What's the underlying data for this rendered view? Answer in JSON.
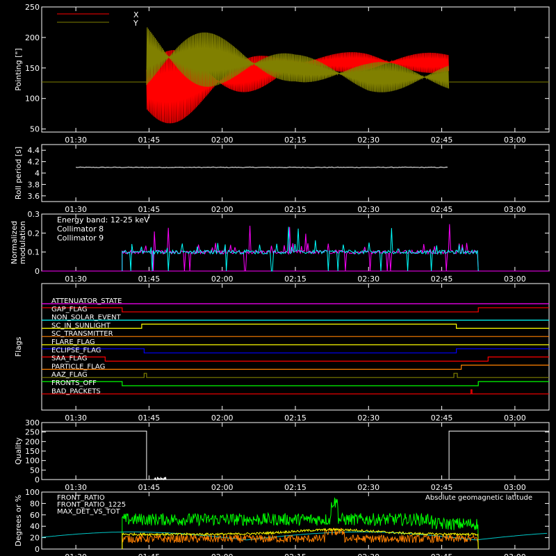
{
  "time_axis": {
    "tick_labels": [
      "01:30",
      "01:45",
      "02:00",
      "02:15",
      "02:30",
      "02:45",
      "03:00"
    ],
    "tick_minutes": [
      90,
      105,
      120,
      135,
      150,
      165,
      180
    ],
    "range_minutes": [
      83,
      187
    ]
  },
  "chart_data": [
    {
      "name": "pointing",
      "type": "line",
      "ylabel": "Pointing [\"]",
      "ylim": [
        45,
        250
      ],
      "yticks": [
        50,
        100,
        150,
        200,
        250
      ],
      "legend": "top-left",
      "series": [
        {
          "name": "X",
          "color": "#ff0000",
          "baseline": 127,
          "start": 104.5,
          "end": 166.5,
          "amp_start": [
            48,
            95
          ],
          "center_path": [
            [
              104.5,
              115
            ],
            [
              120,
              128
            ],
            [
              135,
              158
            ],
            [
              150,
              160
            ],
            [
              166.5,
              158
            ]
          ],
          "halfwidth_path": [
            [
              104.5,
              70
            ],
            [
              120,
              42
            ],
            [
              135,
              12
            ],
            [
              150,
              18
            ],
            [
              166.5,
              16
            ]
          ]
        },
        {
          "name": "Y",
          "color": "#808000",
          "baseline": 127,
          "start": 104.5,
          "end": 166.5,
          "center_path": [
            [
              104.5,
              170
            ],
            [
              120,
              162
            ],
            [
              135,
              150
            ],
            [
              150,
              135
            ],
            [
              166.5,
              135
            ]
          ],
          "halfwidth_path": [
            [
              104.5,
              65
            ],
            [
              120,
              40
            ],
            [
              135,
              22
            ],
            [
              150,
              25
            ],
            [
              166.5,
              24
            ]
          ]
        }
      ]
    },
    {
      "name": "roll_period",
      "type": "line",
      "ylabel": "Roll period [s]",
      "ylim": [
        3.5,
        4.5
      ],
      "yticks": [
        3.6,
        3.8,
        4.0,
        4.2,
        4.4
      ],
      "series": [
        {
          "color": "#ffffff",
          "start": 90,
          "end": 166.5,
          "value": 4.1
        }
      ]
    },
    {
      "name": "modulation",
      "type": "bar",
      "ylabel": "Normalized modulation",
      "ylim": [
        0,
        0.3
      ],
      "yticks": [
        0.0,
        0.1,
        0.2,
        0.3
      ],
      "annotations": [
        "Energy band: 12-25 keV"
      ],
      "series": [
        {
          "name": "Collimator 8",
          "color": "#00ffff",
          "start": 99.5,
          "end": 172.5,
          "base": 0.09
        },
        {
          "name": "Collimator 9",
          "color": "#ff00ff",
          "start": 99.5,
          "end": 172.5,
          "base": 0.09
        }
      ]
    },
    {
      "name": "flags",
      "type": "line",
      "ylabel": "Flags",
      "flags": [
        {
          "label": "ATTENUATOR_STATE",
          "color": "#ff00ff",
          "changes": []
        },
        {
          "label": "GAP_FLAG",
          "color": "#ff0000",
          "changes": [
            [
              99.5,
              1,
              0
            ],
            [
              172.5,
              0,
              1
            ]
          ]
        },
        {
          "label": "NON_SOLAR_EVENT",
          "color": "#00ffff",
          "changes": []
        },
        {
          "label": "SC_IN_SUNLIGHT",
          "color": "#ffff00",
          "changes": [
            [
              103.5,
              0,
              1
            ],
            [
              168,
              1,
              0
            ]
          ]
        },
        {
          "label": "SC_TRANSMITTER",
          "color": "#ff8000",
          "changes": []
        },
        {
          "label": "FLARE_FLAG",
          "color": "#ffff00",
          "changes": []
        },
        {
          "label": "ECLIPSE_FLAG",
          "color": "#0000ff",
          "changes": [
            [
              104,
              1,
              0
            ],
            [
              168,
              0,
              1
            ]
          ]
        },
        {
          "label": "SAA_FLAG",
          "color": "#ff0000",
          "changes": [
            [
              96,
              1,
              0
            ],
            [
              174.5,
              0,
              1
            ]
          ]
        },
        {
          "label": "PARTICLE_FLAG",
          "color": "#ff8000",
          "changes": [
            [
              169,
              0,
              1
            ]
          ]
        },
        {
          "label": "AAZ_FLAG",
          "color": "#808000",
          "pulses": [
            [
              104,
              104.5
            ],
            [
              167.5,
              168.2
            ]
          ]
        },
        {
          "label": "FRONTS_OFF",
          "color": "#00ff00",
          "changes": [
            [
              99.5,
              1,
              0
            ],
            [
              172.5,
              0,
              1
            ]
          ]
        },
        {
          "label": "BAD_PACKETS",
          "color": "#ff0000",
          "pulses": [
            [
              171,
              171.2
            ]
          ]
        }
      ]
    },
    {
      "name": "quality",
      "type": "line",
      "ylabel": "Quality",
      "ylim": [
        0,
        300
      ],
      "yticks": [
        0,
        50,
        100,
        150,
        200,
        250,
        300
      ],
      "series": [
        {
          "color": "#ffffff",
          "high": 255,
          "low_start": 104.5,
          "high_resume": 166.5
        }
      ]
    },
    {
      "name": "front_ratio",
      "type": "line",
      "ylabel": "Degrees or %",
      "ylim": [
        0,
        100
      ],
      "yticks": [
        0,
        20,
        40,
        60,
        80,
        100
      ],
      "legend_right": "Absolute geomagnetic latitude",
      "series": [
        {
          "name": "FRONT_RATIO",
          "color": "#ffff00",
          "start": 99.5,
          "end": 172.5
        },
        {
          "name": "FRONT_RATIO_1225",
          "color": "#00ff00",
          "start": 99.5,
          "end": 172.5
        },
        {
          "name": "MAX_DET_VS_TOT",
          "color": "#ff8000",
          "start": 99.5,
          "end": 172.5
        },
        {
          "name": "Absolute geomagnetic latitude",
          "color": "#00c8c8"
        }
      ]
    }
  ]
}
